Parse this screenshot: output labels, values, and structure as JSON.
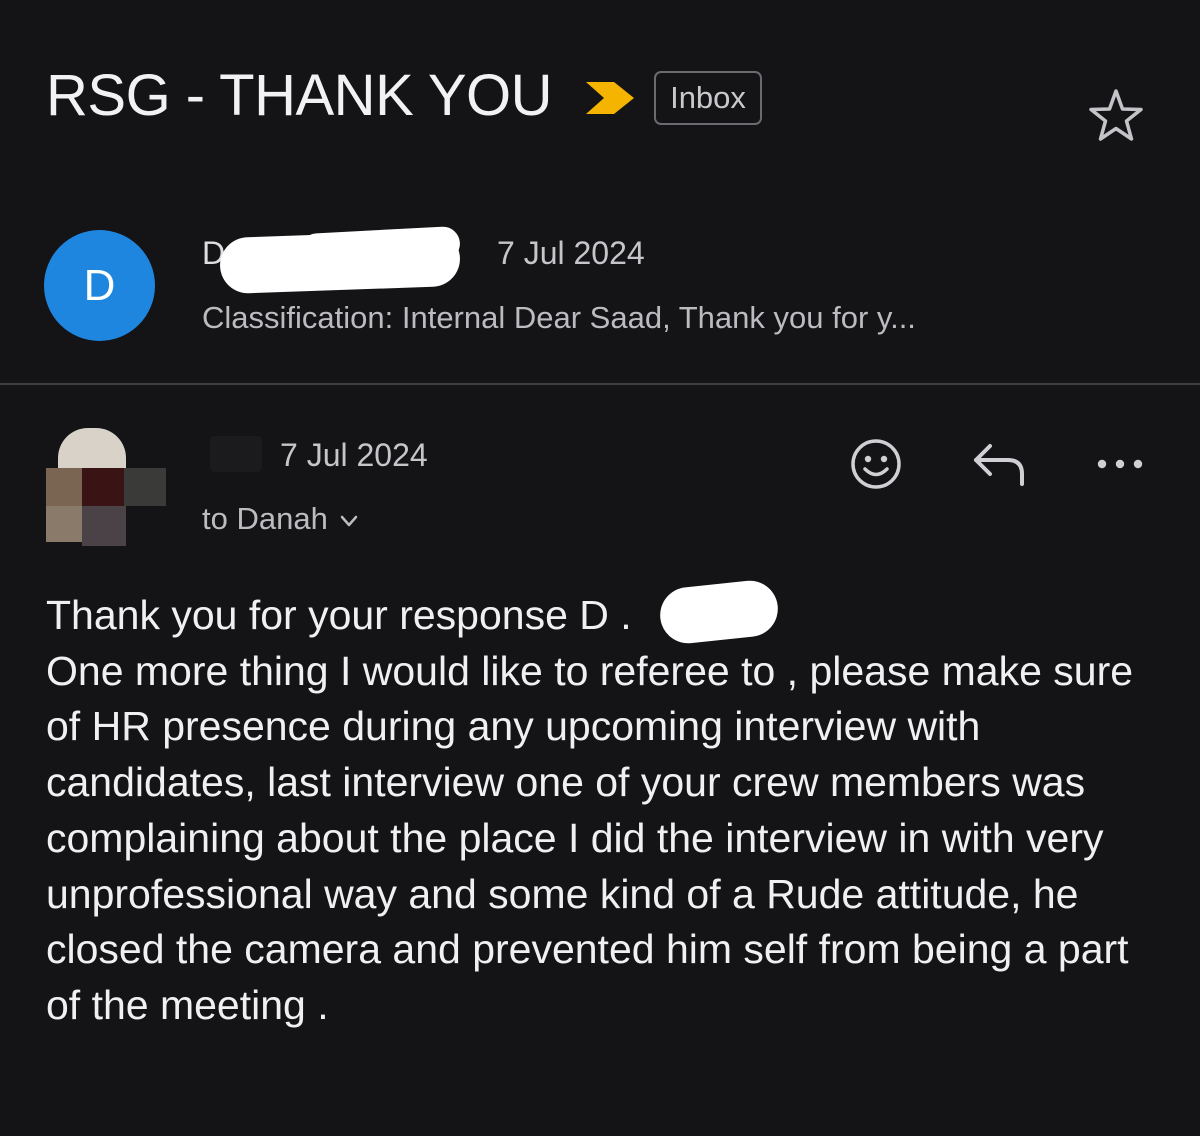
{
  "header": {
    "subject": "RSG - THANK YOU",
    "label_badge": "Inbox",
    "importance_icon": "importance-marker-icon",
    "star_icon": "star-outline-icon",
    "importance_color": "#f5b400"
  },
  "thread": [
    {
      "avatar_letter": "D",
      "avatar_color": "#1f86e0",
      "sender_visible": "D                          h",
      "date": "7 Jul 2024",
      "snippet": "Classification: Internal Dear Saad, Thank you for y..."
    },
    {
      "date": "7 Jul 2024",
      "to_line": "to Danah",
      "actions": {
        "emoji_icon": "smiley-reaction-icon",
        "reply_icon": "reply-icon",
        "more_icon": "more-horizontal-icon"
      },
      "body": "Thank you for your response D          .\nOne more thing I would like to referee to , please make sure of HR presence during any upcoming interview with candidates, last interview one of your crew members was complaining about the place I did the interview in with very unprofessional way and some kind of a Rude attitude, he closed the camera and prevented him self from being a part of the meeting ."
    }
  ]
}
